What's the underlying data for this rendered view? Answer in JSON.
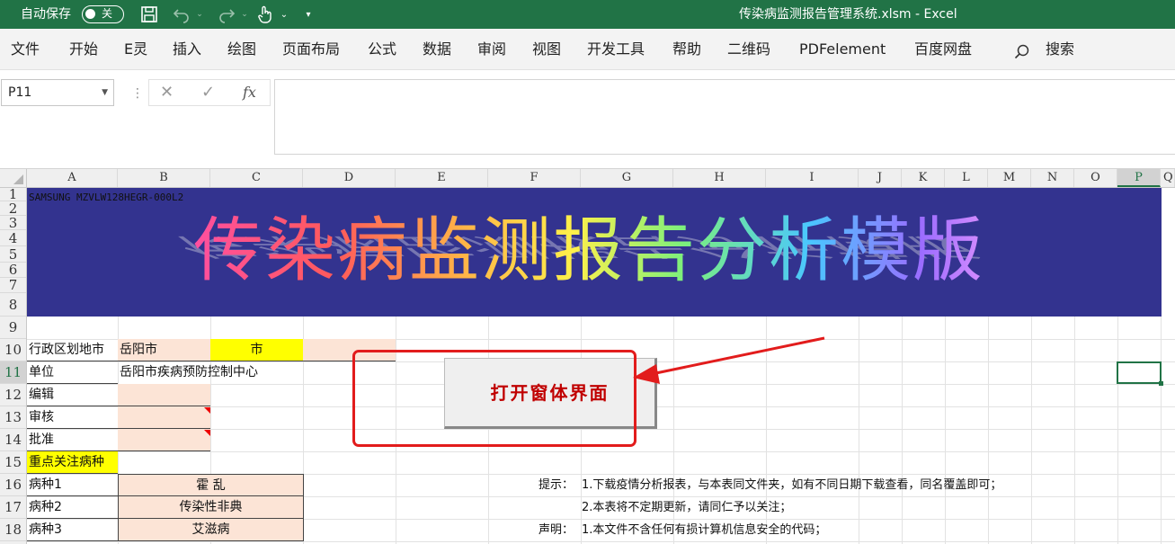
{
  "titlebar": {
    "autosave_label": "自动保存",
    "autosave_state": "关",
    "document_title": "传染病监测报告管理系统.xlsm  -  Excel",
    "icons": [
      "save-icon",
      "undo-icon",
      "redo-icon",
      "touch-mode-icon",
      "customize-qat-icon"
    ],
    "accent": "#217346"
  },
  "ribbon": {
    "tabs": [
      "文件",
      "开始",
      "E灵",
      "插入",
      "绘图",
      "页面布局",
      "公式",
      "数据",
      "审阅",
      "视图",
      "开发工具",
      "帮助",
      "二维码",
      "PDFelement",
      "百度网盘"
    ],
    "search_label": "搜索"
  },
  "formula_bar": {
    "name_box": "P11",
    "cancel": "✕",
    "enter": "✓",
    "fx": "fx",
    "value": ""
  },
  "columns": [
    "A",
    "B",
    "C",
    "D",
    "E",
    "F",
    "G",
    "H",
    "I",
    "J",
    "K",
    "L",
    "M",
    "N",
    "O",
    "P",
    "Q"
  ],
  "rows": [
    "1",
    "2",
    "3",
    "4",
    "5",
    "6",
    "7",
    "8",
    "9",
    "10",
    "11",
    "12",
    "13",
    "14",
    "15",
    "16",
    "17",
    "18"
  ],
  "sheet": {
    "serial": "SAMSUNG MZVLW128HEGR-000L2",
    "banner_title": "传染病监测报告分析模版",
    "banner_color": "#33338f",
    "a10": "行政区划地市",
    "b10": "岳阳市",
    "c10": "市",
    "a11": "单位",
    "b11": "岳阳市疾病预防控制中心",
    "a12": "编辑",
    "a13": "审核",
    "a14": "批准",
    "a15": "重点关注病种",
    "a16": "病种1",
    "b16": "霍  乱",
    "a17": "病种2",
    "b17": "传染性非典",
    "a18": "病种3",
    "b18": "艾滋病",
    "open_button": "打开窗体界面",
    "notes": {
      "hint_label": "提示：",
      "hint1": "1.下载疫情分析报表，与本表同文件夹，如有不同日期下载查看，同名覆盖即可；",
      "hint2": "2.本表将不定期更新，请同仁予以关注；",
      "decl_label": "声明：",
      "decl1": "1.本文件不含任何有损计算机信息安全的代码；"
    }
  }
}
